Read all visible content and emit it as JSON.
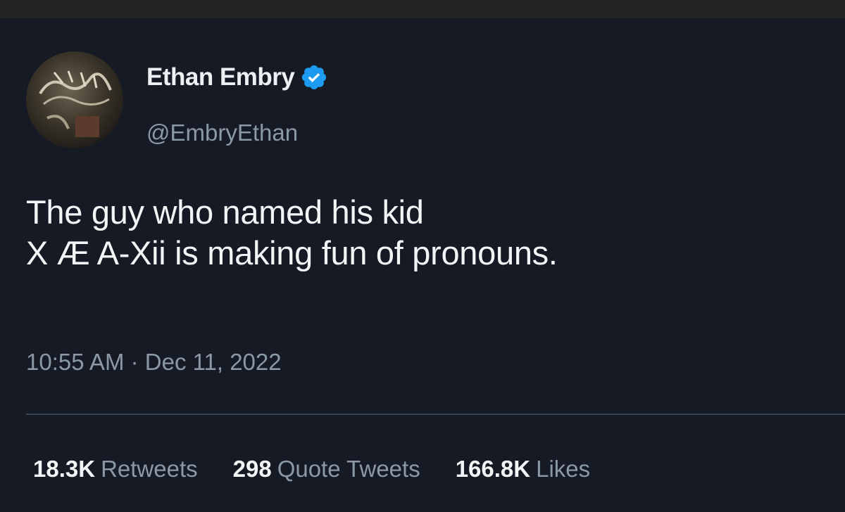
{
  "tweet": {
    "author": {
      "display_name": "Ethan Embry",
      "handle": "@EmbryEthan",
      "verified_icon": "verified-badge-icon",
      "badge_color": "#1d9bf0"
    },
    "text_lines": [
      "The guy who named his kid",
      "X Æ A-Xii is making fun of pronouns."
    ],
    "timestamp": "10:55 AM · Dec 11, 2022",
    "stats": [
      {
        "count": "18.3K",
        "label": "Retweets"
      },
      {
        "count": "298",
        "label": "Quote Tweets"
      },
      {
        "count": "166.8K",
        "label": "Likes"
      }
    ]
  },
  "colors": {
    "background": "#151a24",
    "primary_text": "#f2f4f6",
    "secondary_text": "#8b98a5",
    "divider": "#38444d"
  }
}
